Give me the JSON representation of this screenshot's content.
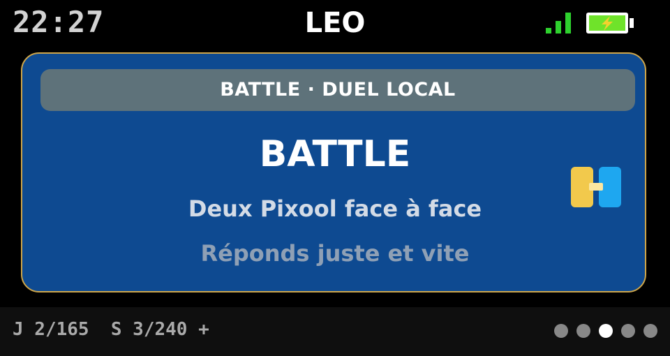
{
  "status_bar": {
    "time": "22:27",
    "player_name": "LEO",
    "signal_icon": "signal-bars-icon",
    "battery_icon": "battery-charging-icon",
    "colors": {
      "signal": "#2ed12e",
      "battery": "#6fe32a",
      "battery_bolt": "#f2d22e"
    }
  },
  "card": {
    "header": "BATTLE · DUEL LOCAL",
    "title": "BATTLE",
    "subtitle": "Deux Pixool face à face",
    "hint": "Réponds juste et vite",
    "icon": "duel-icon",
    "colors": {
      "background": "#0e4a91",
      "border": "#cfa64a",
      "header_bg": "#5e727a",
      "icon_left": "#f2c94c",
      "icon_right": "#1ea7f0"
    }
  },
  "bottom_bar": {
    "progress": "J 2/165  S 3/240 +",
    "pages": {
      "count": 5,
      "active_index": 2
    }
  }
}
